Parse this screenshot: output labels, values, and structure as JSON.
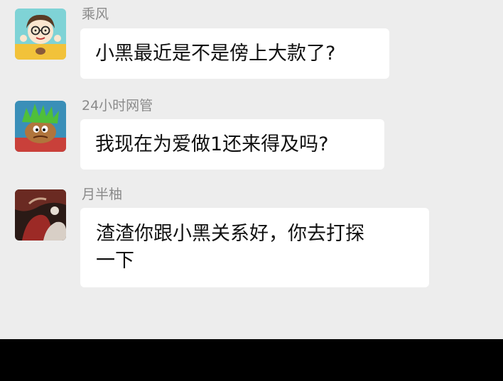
{
  "messages": [
    {
      "sender": "乘风",
      "text": "小黑最近是不是傍上大款了?",
      "avatar_icon": "cartoon-girl-glasses"
    },
    {
      "sender": "24小时网管",
      "text": "我现在为爱做1还来得及吗?",
      "avatar_icon": "cartoon-green-hair"
    },
    {
      "sender": "月半柚",
      "lines": [
        "渣渣你跟小黑关系好，你去打探",
        "一下"
      ],
      "avatar_icon": "photo-dark-red"
    }
  ],
  "colors": {
    "background": "#ededed",
    "bubble": "#ffffff",
    "sender_text": "#8a8a8a",
    "message_text": "#111111"
  }
}
